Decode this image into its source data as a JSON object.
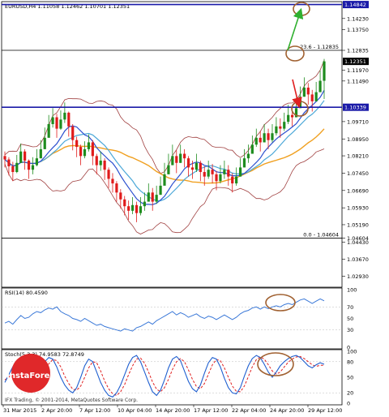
{
  "header": {
    "symbol_line": "EURUSD,H4  1.11058  1.12462  1.10701  1.12351"
  },
  "colors": {
    "bull": "#1e8c1e",
    "bear": "#e01b1b",
    "bands": "#a04040",
    "ma_fast": "#2b4fcf",
    "ma_mid": "#4ca8d8",
    "ma_slow": "#f0a020",
    "level_blue": "#1a1aa8",
    "rsi": "#3a78d8",
    "stoch_main": "#1f5fd0",
    "stoch_signal": "#e02020",
    "arrow_up": "#2fb02f",
    "arrow_down": "#e02020",
    "circle": "#a06030",
    "logo_red": "#e0282a"
  },
  "chart_data": [
    {
      "type": "candlestick",
      "title": "EURUSD,H4  1.11058  1.12462  1.10701  1.12351",
      "ylim": [
        1.0245,
        1.1497
      ],
      "y_ticks": [
        1.14842,
        1.1423,
        1.1375,
        1.12835,
        1.12351,
        1.1197,
        1.1149,
        1.10339,
        1.0971,
        1.0895,
        1.0821,
        1.0745,
        1.0669,
        1.0593,
        1.0519,
        1.04604,
        1.0443,
        1.0367,
        1.0293
      ],
      "y_tick_labels": [
        "1.14842",
        "1.14230",
        "1.13750",
        "1.12835",
        "1.12351",
        "1.11970",
        "1.11490",
        "1.10339",
        "1.09710",
        "1.08950",
        "1.08210",
        "1.07450",
        "1.06690",
        "1.05930",
        "1.05190",
        "1.04604",
        "1.04430",
        "1.03670",
        "1.02930"
      ],
      "price_badges": [
        {
          "value": 1.14842,
          "label": "1.14842",
          "color": "#1a1aa8"
        },
        {
          "value": 1.12351,
          "label": "1.12351",
          "color": "#000000"
        },
        {
          "value": 1.10339,
          "label": "1.10339",
          "color": "#1a1aa8"
        }
      ],
      "horizontal_levels": [
        {
          "value": 1.14842,
          "color": "#1a1aa8",
          "label": ""
        },
        {
          "value": 1.12835,
          "color": "#000000",
          "label": "23.6 - 1.12835"
        },
        {
          "value": 1.10339,
          "color": "#1a1aa8",
          "label": ""
        },
        {
          "value": 1.04604,
          "color": "#000000",
          "label": "0.0 - 1.04604"
        }
      ],
      "closes": [
        1.0805,
        1.0775,
        1.075,
        1.079,
        1.084,
        1.08,
        1.076,
        1.078,
        1.081,
        1.085,
        1.09,
        1.096,
        1.099,
        1.094,
        1.098,
        1.101,
        1.095,
        1.089,
        1.086,
        1.082,
        1.085,
        1.088,
        1.082,
        1.078,
        1.08,
        1.076,
        1.072,
        1.07,
        1.066,
        1.063,
        1.06,
        1.058,
        1.0605,
        1.057,
        1.06,
        1.062,
        1.066,
        1.062,
        1.065,
        1.069,
        1.074,
        1.078,
        1.082,
        1.079,
        1.083,
        1.081,
        1.077,
        1.076,
        1.079,
        1.075,
        1.073,
        1.076,
        1.074,
        1.071,
        1.074,
        1.076,
        1.073,
        1.07,
        1.073,
        1.077,
        1.081,
        1.083,
        1.087,
        1.09,
        1.088,
        1.092,
        1.089,
        1.092,
        1.095,
        1.094,
        1.097,
        1.1,
        1.099,
        1.103,
        1.108,
        1.112,
        1.109,
        1.106,
        1.11,
        1.115,
        1.1235
      ],
      "highs": [
        1.084,
        1.0815,
        1.0795,
        1.0825,
        1.0875,
        1.085,
        1.0805,
        1.0815,
        1.085,
        1.089,
        1.0945,
        1.1,
        1.103,
        1.1005,
        1.102,
        1.1055,
        1.1015,
        1.096,
        1.0905,
        1.087,
        1.0885,
        1.0915,
        1.089,
        1.083,
        1.084,
        1.081,
        1.077,
        1.0745,
        1.071,
        1.0675,
        1.0645,
        1.0625,
        1.064,
        1.062,
        1.064,
        1.066,
        1.07,
        1.068,
        1.069,
        1.073,
        1.079,
        1.083,
        1.087,
        1.0845,
        1.087,
        1.085,
        1.082,
        1.08,
        1.083,
        1.08,
        1.0775,
        1.08,
        1.0785,
        1.0755,
        1.078,
        1.08,
        1.078,
        1.0745,
        1.077,
        1.081,
        1.085,
        1.087,
        1.091,
        1.094,
        1.093,
        1.096,
        1.094,
        1.096,
        1.099,
        1.0985,
        1.101,
        1.1045,
        1.1035,
        1.1075,
        1.1125,
        1.1165,
        1.114,
        1.111,
        1.1145,
        1.1195,
        1.1246
      ],
      "lows": [
        1.077,
        1.0735,
        1.071,
        1.0745,
        1.079,
        1.076,
        1.072,
        1.074,
        1.0775,
        1.081,
        1.0855,
        1.0915,
        1.0945,
        1.09,
        1.0935,
        1.0965,
        1.0905,
        1.0845,
        1.0815,
        1.078,
        1.081,
        1.084,
        1.078,
        1.074,
        1.0755,
        1.0715,
        1.068,
        1.066,
        1.062,
        1.059,
        1.056,
        1.054,
        1.0565,
        1.053,
        1.056,
        1.058,
        1.062,
        1.058,
        1.061,
        1.065,
        1.07,
        1.074,
        1.078,
        1.0745,
        1.079,
        1.077,
        1.073,
        1.072,
        1.075,
        1.071,
        1.069,
        1.072,
        1.07,
        1.067,
        1.07,
        1.072,
        1.069,
        1.066,
        1.069,
        1.073,
        1.077,
        1.079,
        1.083,
        1.086,
        1.084,
        1.088,
        1.085,
        1.088,
        1.091,
        1.09,
        1.093,
        1.096,
        1.095,
        1.099,
        1.104,
        1.108,
        1.1045,
        1.1015,
        1.106,
        1.1105,
        1.107
      ]
    },
    {
      "type": "line",
      "title": "RSI(14) 80.4590",
      "ylim": [
        0,
        100
      ],
      "y_ticks": [
        0,
        30,
        50,
        70,
        100
      ],
      "series": [
        {
          "name": "RSI(14)",
          "values": [
            42,
            45,
            40,
            48,
            55,
            50,
            52,
            58,
            62,
            60,
            65,
            68,
            66,
            70,
            62,
            58,
            55,
            50,
            48,
            45,
            50,
            46,
            42,
            38,
            40,
            36,
            34,
            32,
            30,
            28,
            32,
            30,
            28,
            34,
            36,
            40,
            44,
            40,
            46,
            50,
            54,
            58,
            62,
            56,
            60,
            57,
            52,
            55,
            58,
            53,
            50,
            54,
            52,
            48,
            52,
            56,
            52,
            48,
            52,
            58,
            62,
            64,
            68,
            70,
            66,
            70,
            67,
            70,
            72,
            70,
            74,
            76,
            74,
            78,
            82,
            84,
            80,
            76,
            80,
            84,
            80.5
          ]
        }
      ]
    },
    {
      "type": "line",
      "title": "Stoch(5,3,3) 74.9583 72.8749",
      "ylim": [
        0,
        100
      ],
      "y_ticks": [
        0,
        20,
        50,
        80,
        100
      ],
      "series": [
        {
          "name": "main",
          "values": [
            40,
            55,
            70,
            82,
            78,
            60,
            40,
            30,
            45,
            65,
            80,
            88,
            85,
            70,
            50,
            35,
            25,
            20,
            30,
            50,
            72,
            85,
            80,
            60,
            40,
            25,
            15,
            12,
            20,
            35,
            55,
            75,
            88,
            92,
            80,
            60,
            40,
            22,
            15,
            25,
            45,
            68,
            85,
            90,
            82,
            62,
            42,
            28,
            22,
            35,
            58,
            78,
            88,
            85,
            70,
            48,
            30,
            20,
            18,
            30,
            52,
            72,
            86,
            92,
            88,
            75,
            60,
            50,
            60,
            72,
            80,
            86,
            90,
            92,
            88,
            80,
            72,
            68,
            74,
            78,
            75
          ]
        },
        {
          "name": "signal",
          "values": [
            45,
            50,
            60,
            72,
            78,
            72,
            58,
            42,
            38,
            48,
            62,
            76,
            84,
            82,
            70,
            52,
            38,
            27,
            25,
            33,
            50,
            68,
            80,
            78,
            62,
            43,
            28,
            18,
            15,
            22,
            36,
            55,
            72,
            85,
            87,
            77,
            60,
            41,
            27,
            22,
            30,
            46,
            65,
            80,
            86,
            80,
            64,
            46,
            32,
            28,
            38,
            56,
            74,
            84,
            82,
            68,
            50,
            33,
            23,
            22,
            33,
            51,
            70,
            84,
            89,
            85,
            74,
            62,
            56,
            60,
            70,
            79,
            85,
            89,
            90,
            86,
            80,
            74,
            71,
            73,
            72.9
          ]
        }
      ]
    }
  ],
  "x_axis": {
    "labels": [
      "31 Mar 2015",
      "2 Apr 20:00",
      "7 Apr 12:00",
      "10 Apr 04:00",
      "14 Apr 20:00",
      "17 Apr 12:00",
      "22 Apr 04:00",
      "24 Apr 20:00",
      "29 Apr 12:00"
    ]
  },
  "rsi_axis_labels": [
    "100",
    "70",
    "50",
    "30",
    "0"
  ],
  "stoch_axis_labels": [
    "100",
    "80",
    "50",
    "20",
    "0"
  ],
  "watermark": {
    "logo_text": "InstaForex",
    "copyright": "IFX Trading, © 2001-2014, MetaQuotes Software Corp."
  }
}
